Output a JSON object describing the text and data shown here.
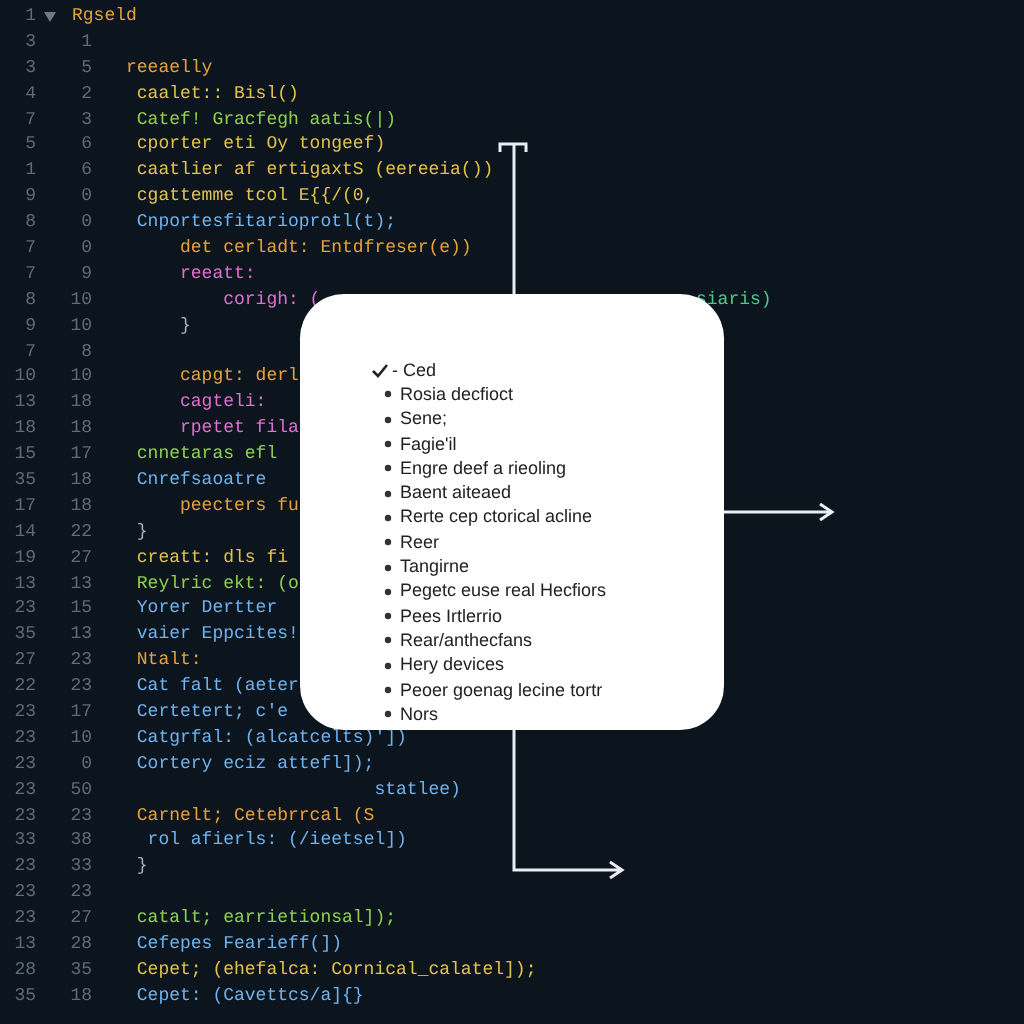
{
  "code_lines": [
    {
      "number": "1",
      "text": "Rgseld",
      "kind": "keyword"
    },
    {
      "number": "3",
      "number_2": "1"
    },
    {
      "number": "3",
      "number_2": "5",
      "text": "     reeaelly",
      "kind": "keyword"
    },
    {
      "number": "4",
      "number_2": "2",
      "text": "      caalet:: Bisl()",
      "kind": "string"
    },
    {
      "number": "7",
      "number_2": "3",
      "text": "      Catef! Gracfegh aatis(|)",
      "kind": "function"
    },
    {
      "number": "5",
      "number_2": "6",
      "text": "      cporter eti Oy tongeef)",
      "kind": "string"
    },
    {
      "number": "1",
      "number_2": "6",
      "text": "      caatlier af ertigaxtS (eereeia())",
      "kind": "string"
    },
    {
      "number": "9",
      "number_2": "0",
      "text": "      cgattemme tcol E{{/(0,",
      "kind": "string"
    },
    {
      "number": "8",
      "number_2": "0",
      "text": "      Cnportesfitarioprotl(t);",
      "kind": "type"
    },
    {
      "number": "7",
      "number_2": "0",
      "text": "          det cerladt: Entdfreser(e))",
      "kind": "keyword"
    },
    {
      "number": "7",
      "number_2": "9",
      "text": "          reeatt:",
      "kind": "property"
    },
    {
      "number": "8",
      "number_2": "10",
      "text": "              corigh: (",
      "kind": "property",
      "tail": "siaris)"
    },
    {
      "number": "9",
      "number_2": "10",
      "text": "          }",
      "kind": "punctuation"
    },
    {
      "number": "7",
      "number_2": "8"
    },
    {
      "number": "10",
      "number_2": "10",
      "text": "          capgt: derl",
      "kind": "keyword"
    },
    {
      "number": "13",
      "number_2": "18",
      "text": "          cagteli:",
      "kind": "property"
    },
    {
      "number": "18",
      "number_2": "18",
      "text": "          rpetet fila",
      "kind": "property"
    },
    {
      "number": "15",
      "number_2": "17",
      "text": "      cnnetaras efl",
      "kind": "function"
    },
    {
      "number": "35",
      "number_2": "18",
      "text": "      Cnrefsaoatre",
      "kind": "type"
    },
    {
      "number": "17",
      "number_2": "18",
      "text": "          peecters fu",
      "kind": "keyword"
    },
    {
      "number": "14",
      "number_2": "22",
      "text": "      }",
      "kind": "punctuation"
    },
    {
      "number": "19",
      "number_2": "27",
      "text": "      creatt: dls fi",
      "kind": "string"
    },
    {
      "number": "13",
      "number_2": "13",
      "text": "      Reylric ekt: (o",
      "kind": "function"
    },
    {
      "number": "23",
      "number_2": "15",
      "text": "      Yorer Dertter",
      "kind": "type"
    },
    {
      "number": "35",
      "number_2": "13",
      "text": "      vaier Eppcites!",
      "kind": "type"
    },
    {
      "number": "27",
      "number_2": "23",
      "text": "      Ntalt:",
      "kind": "keyword"
    },
    {
      "number": "22",
      "number_2": "23",
      "text": "      Cat falt (aeter",
      "kind": "type"
    },
    {
      "number": "23",
      "number_2": "17",
      "text": "      Certetert; c'e",
      "kind": "type"
    },
    {
      "number": "23",
      "number_2": "10",
      "text": "      Catgrfal: (alcatcelts)'])",
      "kind": "type"
    },
    {
      "number": "23",
      "number_2": "0",
      "text": "      Cortery eciz attefl]);",
      "kind": "type"
    },
    {
      "number": "23",
      "number_2": "50",
      "text": "                            statlee)",
      "kind": "type"
    },
    {
      "number": "23",
      "number_2": "23",
      "text": "      Carnelt; Cetebrrcal (S",
      "kind": "keyword"
    },
    {
      "number": "33",
      "number_2": "38",
      "text": "       rol afierls: (/ieetsel])",
      "kind": "type"
    },
    {
      "number": "23",
      "number_2": "33",
      "text": "      }",
      "kind": "punctuation"
    },
    {
      "number": "23",
      "number_2": "23"
    },
    {
      "number": "23",
      "number_2": "27",
      "text": "      catalt; earrietionsal]);",
      "kind": "function"
    },
    {
      "number": "13",
      "number_2": "28",
      "text": "      Cefepes Fearieff(])",
      "kind": "type"
    },
    {
      "number": "28",
      "number_2": "35",
      "text": "      Cepet; (ehefalca: Cornical_calatel]);",
      "kind": "string"
    },
    {
      "number": "35",
      "number_2": "18",
      "text": "      Cepet: (Cavettcs/a]{}",
      "kind": "type"
    }
  ],
  "popup": {
    "items": [
      {
        "label": "- Ced",
        "checked": true
      },
      {
        "label": "Rosia decfioct",
        "checked": false
      },
      {
        "label": "Sene;",
        "checked": false
      },
      {
        "label": "Fagie'il",
        "checked": false
      },
      {
        "label": "Engre deef a rieoling",
        "checked": false
      },
      {
        "label": "Baent aiteaed",
        "checked": false
      },
      {
        "label": "Rerte cep ctorical acline",
        "checked": false
      },
      {
        "label": "Reer",
        "checked": false
      },
      {
        "label": "Tangirne",
        "checked": false
      },
      {
        "label": "Pegetc euse real Hecfiors",
        "checked": false
      },
      {
        "label": "Pees Irtlerrio",
        "checked": false
      },
      {
        "label": "Rear/anthecfans",
        "checked": false
      },
      {
        "label": "Hery devices",
        "checked": false
      },
      {
        "label": "Peoer goenag lecine tortr",
        "checked": false
      },
      {
        "label": "Nors",
        "checked": false
      }
    ]
  }
}
